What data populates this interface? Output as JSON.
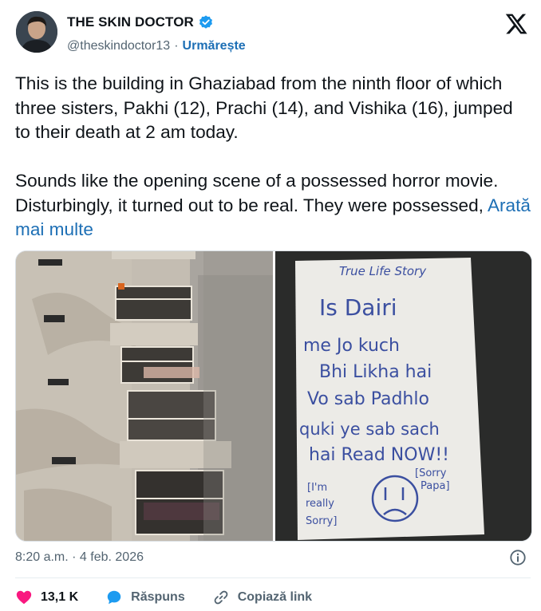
{
  "author": {
    "name": "THE SKIN DOCTOR",
    "handle": "@theskindoctor13",
    "follow_label": "Urmărește",
    "separator": "·"
  },
  "tweet": {
    "text": "This is the building in Ghaziabad from the ninth floor of which three sisters, Pakhi (12), Prachi (14), and Vishika (16), jumped to their death at 2 am today.\n\nSounds like the opening scene of a possessed horror movie. Disturbingly, it turned out to be real. They were possessed, ",
    "show_more": "Arată mai multe"
  },
  "media": {
    "note_lines": [
      "True Life Story",
      "Is Dairi",
      "me Jo kuch",
      "Bhi Likha hai",
      "Vo sab Padhlo",
      "quki ye sab sach",
      "hai Read NOW!!",
      "[Sorry",
      "Papa]",
      "[I'm",
      "really",
      "Sorry]"
    ]
  },
  "timestamp": "8:20 a.m. · 4 feb. 2026",
  "actions": {
    "likes": "13,1 K",
    "reply_label": "Răspuns",
    "copy_link_label": "Copiază link"
  },
  "colors": {
    "accent": "#1d6fb5",
    "like": "#f91880",
    "muted": "#536471",
    "verified": "#1d9bf0"
  },
  "icons": [
    "verified-badge-icon",
    "x-logo-icon",
    "info-icon",
    "heart-icon",
    "reply-bubble-icon",
    "link-icon"
  ]
}
